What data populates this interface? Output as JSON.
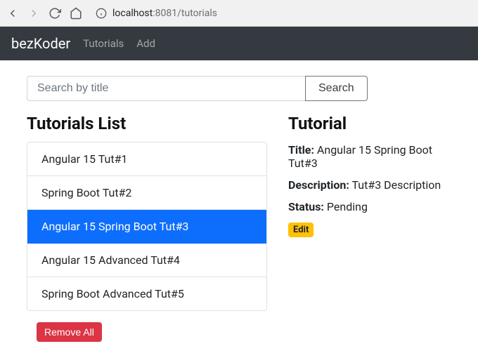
{
  "browser": {
    "url_host": "localhost",
    "url_port": ":8081",
    "url_path": "/tutorials"
  },
  "navbar": {
    "brand": "bezKoder",
    "links": [
      {
        "label": "Tutorials"
      },
      {
        "label": "Add"
      }
    ]
  },
  "search": {
    "placeholder": "Search by title",
    "button_label": "Search"
  },
  "list": {
    "heading": "Tutorials List",
    "items": [
      {
        "title": "Angular 15 Tut#1",
        "active": false
      },
      {
        "title": "Spring Boot Tut#2",
        "active": false
      },
      {
        "title": "Angular 15 Spring Boot Tut#3",
        "active": true
      },
      {
        "title": "Angular 15 Advanced Tut#4",
        "active": false
      },
      {
        "title": "Spring Boot Advanced Tut#5",
        "active": false
      }
    ],
    "remove_all_label": "Remove All"
  },
  "detail": {
    "heading": "Tutorial",
    "title_label": "Title:",
    "title_value": "Angular 15 Spring Boot Tut#3",
    "description_label": "Description:",
    "description_value": "Tut#3 Description",
    "status_label": "Status:",
    "status_value": "Pending",
    "edit_label": "Edit"
  }
}
